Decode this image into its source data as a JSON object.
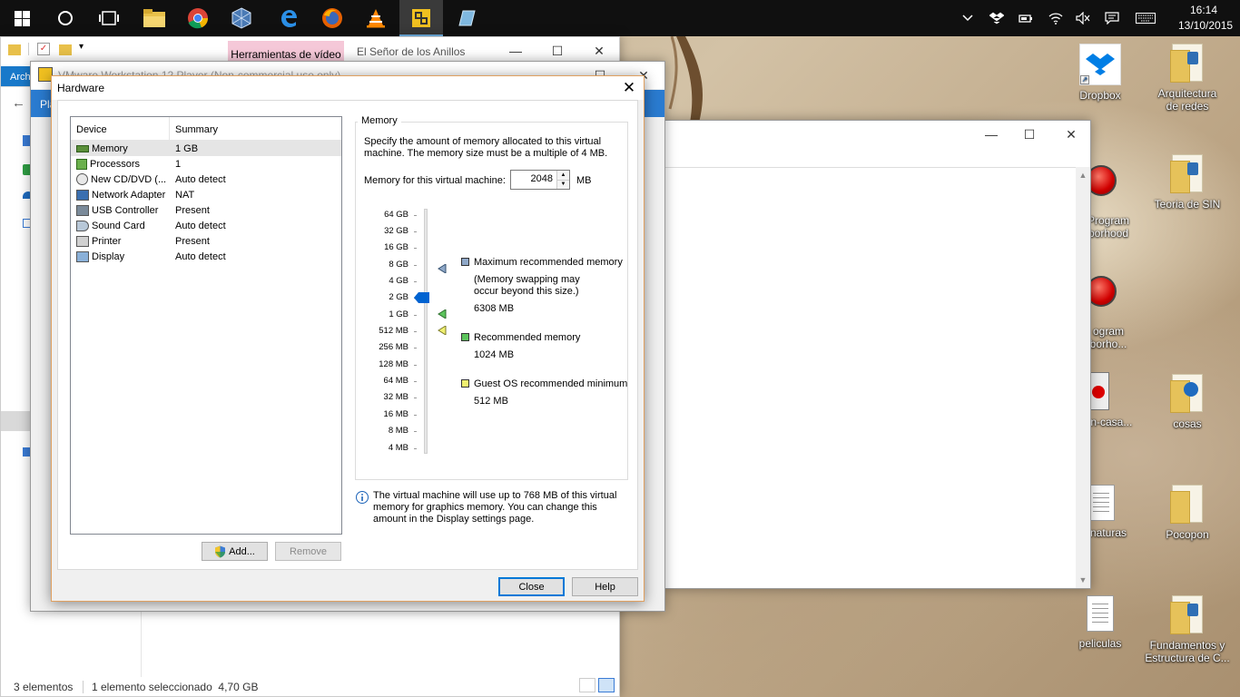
{
  "taskbar": {
    "apps": [
      "start",
      "cortana",
      "task-view",
      "file-explorer",
      "chrome",
      "virtualbox",
      "edge",
      "firefox",
      "vlc",
      "vmware-player",
      "notes"
    ],
    "time": "16:14",
    "date": "13/10/2015"
  },
  "desktop_icons": [
    {
      "label": "Dropbox",
      "icon": "dropbox"
    },
    {
      "label": "Arquitectura de redes",
      "icon": "folder"
    },
    {
      "label": "Program\nborhood",
      "icon": "red-ball"
    },
    {
      "label": "Teoria de SIN",
      "icon": "folder"
    },
    {
      "label": "ogram\nborho...",
      "icon": "red-ball"
    },
    {
      "label": "on-casa...",
      "icon": "red-ball"
    },
    {
      "label": "cosas",
      "icon": "folder"
    },
    {
      "label": "naturas",
      "icon": "document"
    },
    {
      "label": "Pocopon",
      "icon": "folder"
    },
    {
      "label": "peliculas",
      "icon": "document"
    },
    {
      "label": "Fundamentos y Estructura de C...",
      "icon": "folder"
    }
  ],
  "explorer": {
    "ribbon_tab": "Herramientas de vídeo",
    "title": "El Señor de los Anillos",
    "file_tab": "Arch",
    "status_items": "3 elementos",
    "status_selected": "1 elemento seleccionado  4,70 GB"
  },
  "vmware": {
    "title": "VMware Workstation 12 Player (Non-commercial use only)",
    "menu": "Pla"
  },
  "dialog": {
    "title": "Hardware",
    "columns": {
      "device": "Device",
      "summary": "Summary"
    },
    "devices": [
      {
        "name": "Memory",
        "summary": "1 GB",
        "icon": "memory-icon",
        "selected": true
      },
      {
        "name": "Processors",
        "summary": "1",
        "icon": "processor-icon"
      },
      {
        "name": "New CD/DVD (...",
        "summary": "Auto detect",
        "icon": "cd-dvd-icon"
      },
      {
        "name": "Network Adapter",
        "summary": "NAT",
        "icon": "network-icon"
      },
      {
        "name": "USB Controller",
        "summary": "Present",
        "icon": "usb-icon"
      },
      {
        "name": "Sound Card",
        "summary": "Auto detect",
        "icon": "sound-icon"
      },
      {
        "name": "Printer",
        "summary": "Present",
        "icon": "printer-icon"
      },
      {
        "name": "Display",
        "summary": "Auto detect",
        "icon": "display-icon"
      }
    ],
    "add_label": "Add...",
    "remove_label": "Remove",
    "close_label": "Close",
    "help_label": "Help",
    "memory": {
      "group_title": "Memory",
      "description": "Specify the amount of memory allocated to this virtual machine. The memory size must be a multiple of 4 MB.",
      "field_label": "Memory for this virtual machine:",
      "field_value": "2048",
      "unit": "MB",
      "scale": [
        "64 GB",
        "32 GB",
        "16 GB",
        "8 GB",
        "4 GB",
        "2 GB",
        "1 GB",
        "512 MB",
        "256 MB",
        "128 MB",
        "64 MB",
        "32 MB",
        "16 MB",
        "8 MB",
        "4 MB"
      ],
      "current_level": "2 GB",
      "max_recommended": {
        "title": "Maximum recommended memory",
        "note": "(Memory swapping may occur beyond this size.)",
        "value": "6308 MB",
        "color": "#8fa8c8"
      },
      "recommended": {
        "title": "Recommended memory",
        "value": "1024 MB",
        "color": "#5cc45c"
      },
      "guest_min": {
        "title": "Guest OS recommended minimum",
        "value": "512 MB",
        "color": "#f0f070"
      },
      "info": "The virtual machine will use up to 768 MB of this virtual memory for graphics memory. You can change this amount in the Display settings page."
    }
  }
}
